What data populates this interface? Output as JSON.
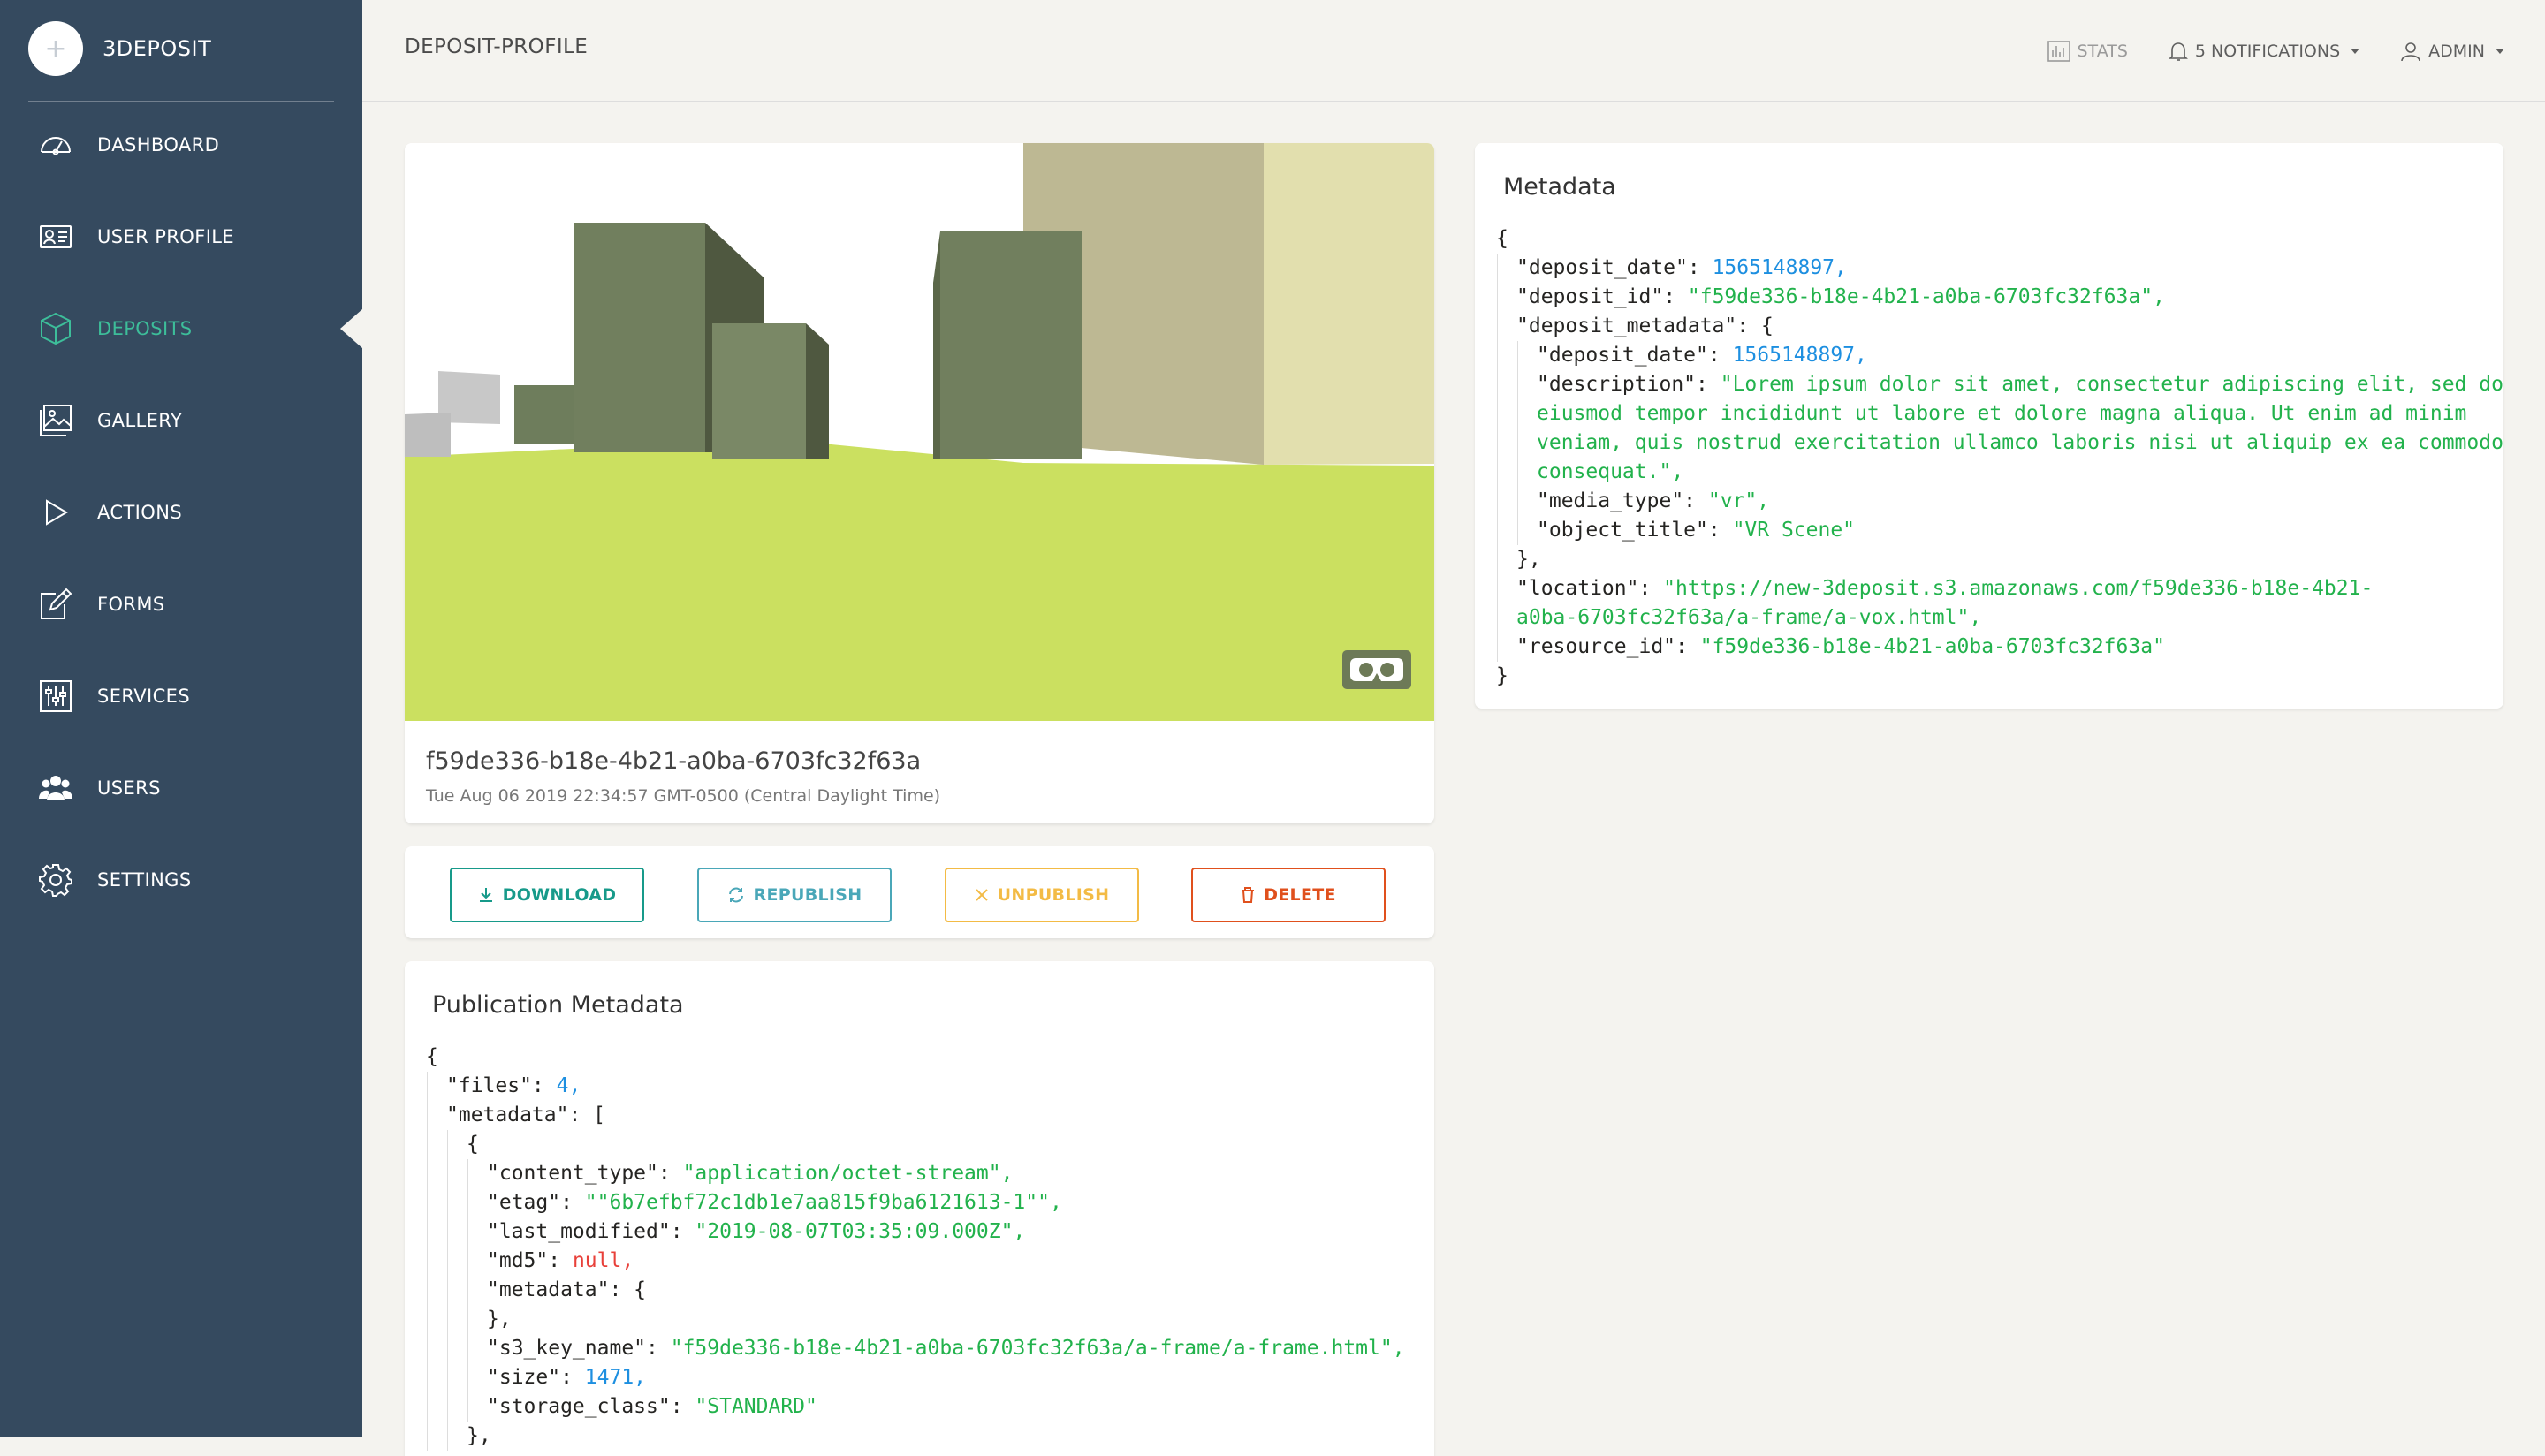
{
  "app": {
    "brand": "3DEPOSIT",
    "logo_glyph": "+"
  },
  "sidebar": {
    "items": [
      {
        "label": "DASHBOARD",
        "icon": "dashboard-gauge-icon"
      },
      {
        "label": "USER PROFILE",
        "icon": "id-card-icon"
      },
      {
        "label": "DEPOSITS",
        "icon": "cube-icon",
        "active": true
      },
      {
        "label": "GALLERY",
        "icon": "gallery-image-icon"
      },
      {
        "label": "ACTIONS",
        "icon": "play-icon"
      },
      {
        "label": "FORMS",
        "icon": "pencil-form-icon"
      },
      {
        "label": "SERVICES",
        "icon": "sliders-icon"
      },
      {
        "label": "USERS",
        "icon": "users-group-icon"
      },
      {
        "label": "SETTINGS",
        "icon": "gear-icon"
      }
    ]
  },
  "topbar": {
    "title": "DEPOSIT-PROFILE",
    "stats_label": "STATS",
    "notifications_label": "5 NOTIFICATIONS",
    "user_label": "ADMIN"
  },
  "deposit": {
    "id": "f59de336-b18e-4b21-a0ba-6703fc32f63a",
    "date": "Tue Aug 06 2019 22:34:57 GMT-0500 (Central Daylight Time)",
    "vr_icon": "vr-headset-icon"
  },
  "actions": {
    "download": "DOWNLOAD",
    "republish": "REPUBLISH",
    "unpublish": "UNPUBLISH",
    "delete": "DELETE"
  },
  "metadata_card": {
    "title": "Metadata",
    "lines": [
      [
        {
          "t": "{",
          "c": "p"
        }
      ],
      [
        {
          "g": 1
        },
        {
          "t": "\"deposit_date\": ",
          "c": "k"
        },
        {
          "t": "1565148897,",
          "c": "n"
        }
      ],
      [
        {
          "g": 1
        },
        {
          "t": "\"deposit_id\": ",
          "c": "k"
        },
        {
          "t": "\"f59de336-b18e-4b21-a0ba-6703fc32f63a\",",
          "c": "s"
        }
      ],
      [
        {
          "g": 1
        },
        {
          "t": "\"deposit_metadata\": {",
          "c": "k"
        }
      ],
      [
        {
          "g": 2
        },
        {
          "t": "\"deposit_date\": ",
          "c": "k"
        },
        {
          "t": "1565148897,",
          "c": "n"
        }
      ],
      [
        {
          "g": 2
        },
        {
          "t": "\"description\": ",
          "c": "k"
        },
        {
          "t": "\"Lorem ipsum dolor sit amet, consectetur adipiscing elit, sed do",
          "c": "s"
        }
      ],
      [
        {
          "g": 2
        },
        {
          "t": "eiusmod tempor incididunt ut labore et dolore magna aliqua. Ut enim ad minim",
          "c": "s"
        }
      ],
      [
        {
          "g": 2
        },
        {
          "t": "veniam, quis nostrud exercitation ullamco laboris nisi ut aliquip ex ea commodo",
          "c": "s"
        }
      ],
      [
        {
          "g": 2
        },
        {
          "t": "consequat.\",",
          "c": "s"
        }
      ],
      [
        {
          "g": 2
        },
        {
          "t": "\"media_type\": ",
          "c": "k"
        },
        {
          "t": "\"vr\",",
          "c": "s"
        }
      ],
      [
        {
          "g": 2
        },
        {
          "t": "\"object_title\": ",
          "c": "k"
        },
        {
          "t": "\"VR Scene\"",
          "c": "s"
        }
      ],
      [
        {
          "g": 1
        },
        {
          "t": "},",
          "c": "k"
        }
      ],
      [
        {
          "g": 1
        },
        {
          "t": "\"location\": ",
          "c": "k"
        },
        {
          "t": "\"https://new-3deposit.s3.amazonaws.com/f59de336-b18e-4b21-",
          "c": "s"
        }
      ],
      [
        {
          "g": 1
        },
        {
          "t": "a0ba-6703fc32f63a/a-frame/a-vox.html\",",
          "c": "s"
        }
      ],
      [
        {
          "g": 1
        },
        {
          "t": "\"resource_id\": ",
          "c": "k"
        },
        {
          "t": "\"f59de336-b18e-4b21-a0ba-6703fc32f63a\"",
          "c": "s"
        }
      ],
      [
        {
          "t": "}",
          "c": "p"
        }
      ]
    ]
  },
  "publication_card": {
    "title": "Publication Metadata",
    "lines": [
      [
        {
          "t": "{",
          "c": "p"
        }
      ],
      [
        {
          "g": 1
        },
        {
          "t": "\"files\": ",
          "c": "k"
        },
        {
          "t": "4,",
          "c": "n"
        }
      ],
      [
        {
          "g": 1
        },
        {
          "t": "\"metadata\": [",
          "c": "k"
        }
      ],
      [
        {
          "g": 2
        },
        {
          "t": "{",
          "c": "k"
        }
      ],
      [
        {
          "g": 3
        },
        {
          "t": "\"content_type\": ",
          "c": "k"
        },
        {
          "t": "\"application/octet-stream\",",
          "c": "s"
        }
      ],
      [
        {
          "g": 3
        },
        {
          "t": "\"etag\": ",
          "c": "k"
        },
        {
          "t": "\"\"6b7efbf72c1db1e7aa815f9ba6121613-1\"\",",
          "c": "s"
        }
      ],
      [
        {
          "g": 3
        },
        {
          "t": "\"last_modified\": ",
          "c": "k"
        },
        {
          "t": "\"2019-08-07T03:35:09.000Z\",",
          "c": "s"
        }
      ],
      [
        {
          "g": 3
        },
        {
          "t": "\"md5\": ",
          "c": "k"
        },
        {
          "t": "null,",
          "c": "x"
        }
      ],
      [
        {
          "g": 3
        },
        {
          "t": "\"metadata\": {",
          "c": "k"
        }
      ],
      [
        {
          "g": 3
        },
        {
          "t": "},",
          "c": "k"
        }
      ],
      [
        {
          "g": 3
        },
        {
          "t": "\"s3_key_name\": ",
          "c": "k"
        },
        {
          "t": "\"f59de336-b18e-4b21-a0ba-6703fc32f63a/a-frame/a-frame.html\",",
          "c": "s"
        }
      ],
      [
        {
          "g": 3
        },
        {
          "t": "\"size\": ",
          "c": "k"
        },
        {
          "t": "1471,",
          "c": "n"
        }
      ],
      [
        {
          "g": 3
        },
        {
          "t": "\"storage_class\": ",
          "c": "k"
        },
        {
          "t": "\"STANDARD\"",
          "c": "s"
        }
      ],
      [
        {
          "g": 2
        },
        {
          "t": "},",
          "c": "k"
        }
      ]
    ]
  },
  "colors": {
    "sidebar_bg": "#354a5f",
    "active": "#3dbe9a",
    "json_number": "#1d8fe0",
    "json_string": "#22b24c",
    "json_null": "#e8403a"
  }
}
